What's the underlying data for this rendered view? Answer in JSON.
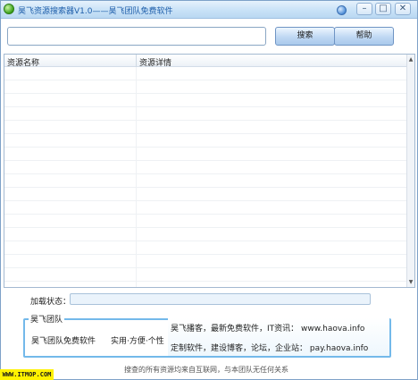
{
  "window": {
    "title": "昊飞资源搜索器V1.0——昊飞团队免费软件",
    "min_glyph": "–",
    "max_glyph": "□",
    "close_glyph": "✕"
  },
  "search": {
    "value": "",
    "placeholder": "",
    "search_label": "搜索",
    "help_label": "帮助"
  },
  "list": {
    "columns": [
      "资源名称",
      "资源详情"
    ],
    "rows": [],
    "scroll_up": "▲",
    "scroll_down": "▼"
  },
  "status": {
    "label": "加载状态：",
    "progress": 0
  },
  "team": {
    "legend": "昊飞团队",
    "name": "昊飞团队免费软件",
    "slogan": "实用·方便·个性",
    "ad_line1": "昊飞播客，最新免费软件，IT资讯： www.haova.info",
    "ad_line2": "定制软件，建设博客，论坛，企业站：  pay.haova.info"
  },
  "footer": {
    "note": "搜查的所有资源均来自互联网，与本团队无任何关系",
    "watermark": "WWW.ITMOP.COM"
  },
  "colors": {
    "title_text": "#1e5eaa",
    "group_border": "#73b9ea",
    "watermark_bg": "#fff200"
  },
  "icons": [
    "app-logo-icon",
    "skin-icon",
    "minimize-icon",
    "maximize-icon",
    "close-icon"
  ]
}
